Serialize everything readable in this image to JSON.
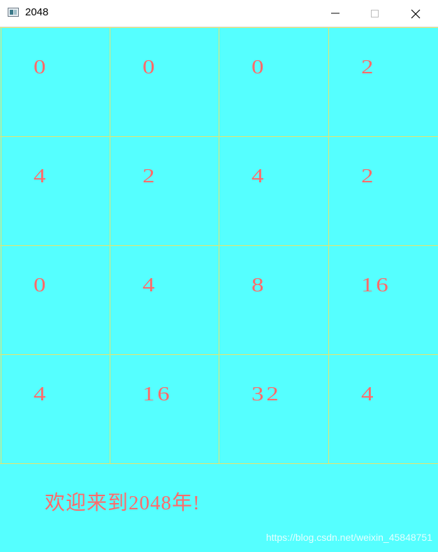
{
  "window": {
    "title": "2048"
  },
  "board": {
    "rows": [
      [
        "0",
        "0",
        "0",
        "2"
      ],
      [
        "4",
        "2",
        "4",
        "2"
      ],
      [
        "0",
        "4",
        "8",
        "16"
      ],
      [
        "4",
        "16",
        "32",
        "4"
      ]
    ]
  },
  "status": {
    "message": "欢迎来到2048年!"
  },
  "watermark": "https://blog.csdn.net/weixin_45848751",
  "colors": {
    "background": "#55ffff",
    "grid_line": "#e9e36a",
    "text": "#ff6b6b"
  }
}
